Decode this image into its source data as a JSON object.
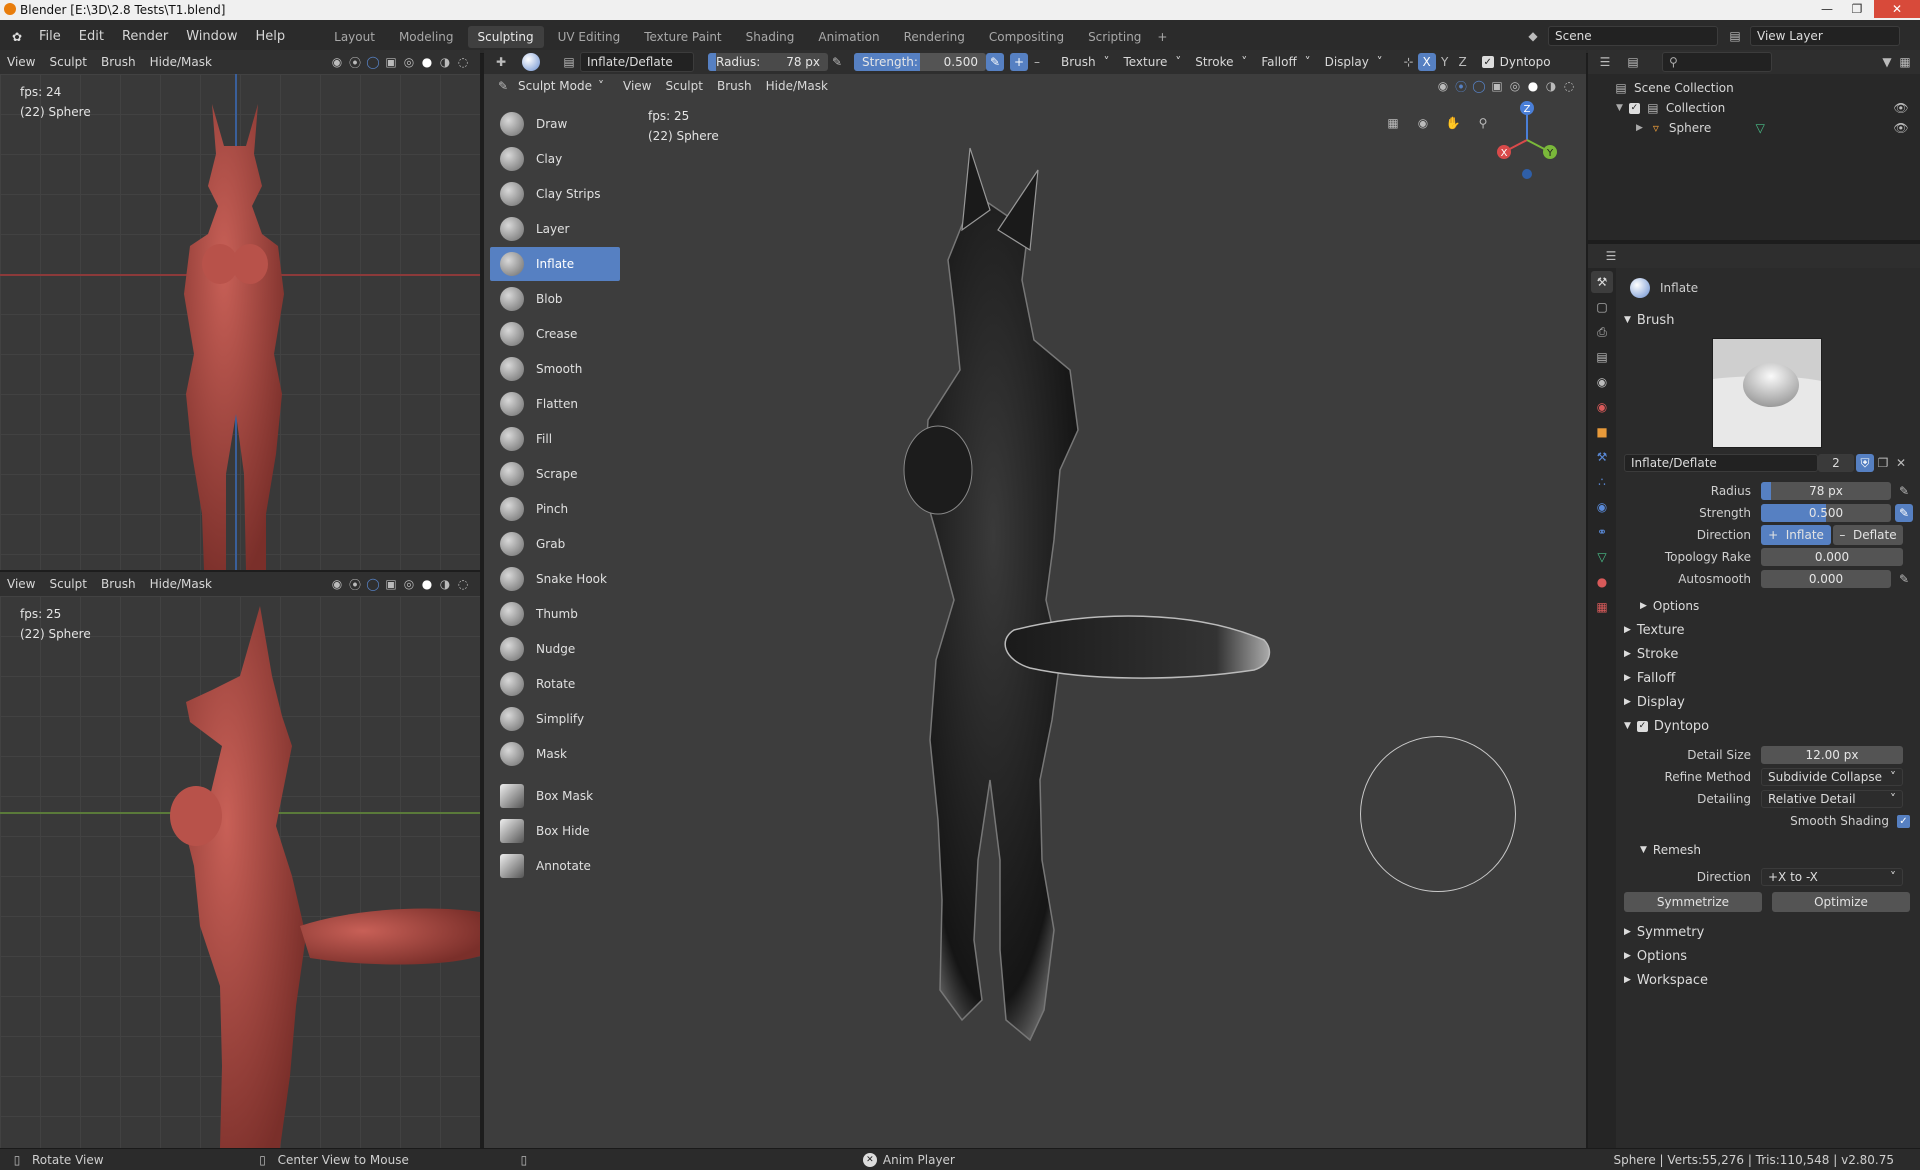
{
  "window": {
    "title": "Blender [E:\\3D\\2.8 Tests\\T1.blend]"
  },
  "menu": [
    "File",
    "Edit",
    "Render",
    "Window",
    "Help"
  ],
  "workspaces": [
    "Layout",
    "Modeling",
    "Sculpting",
    "UV Editing",
    "Texture Paint",
    "Shading",
    "Animation",
    "Rendering",
    "Compositing",
    "Scripting"
  ],
  "active_workspace": "Sculpting",
  "scene_name": "Scene",
  "view_layer": "View Layer",
  "viewport_top": {
    "menus": [
      "View",
      "Sculpt",
      "Brush",
      "Hide/Mask"
    ],
    "fps": "fps: 24",
    "object": "(22) Sphere"
  },
  "viewport_bottom": {
    "menus": [
      "View",
      "Sculpt",
      "Brush",
      "Hide/Mask"
    ],
    "fps": "fps: 25",
    "object": "(22) Sphere"
  },
  "tool_header": {
    "brush_name": "Inflate/Deflate",
    "radius_label": "Radius:",
    "radius_value": "78 px",
    "strength_label": "Strength:",
    "strength_value": "0.500",
    "menus": [
      "Brush",
      "Texture",
      "Stroke",
      "Falloff",
      "Display"
    ],
    "axes": [
      "X",
      "Y",
      "Z"
    ],
    "dyntopo": "Dyntopo"
  },
  "main_viewport": {
    "mode": "Sculpt Mode",
    "menus": [
      "View",
      "Sculpt",
      "Brush",
      "Hide/Mask"
    ],
    "fps": "fps: 25",
    "object": "(22) Sphere"
  },
  "tools": [
    "Draw",
    "Clay",
    "Clay Strips",
    "Layer",
    "Inflate",
    "Blob",
    "Crease",
    "Smooth",
    "Flatten",
    "Fill",
    "Scrape",
    "Pinch",
    "Grab",
    "Snake Hook",
    "Thumb",
    "Nudge",
    "Rotate",
    "Simplify",
    "Mask"
  ],
  "active_tool": "Inflate",
  "extra_tools": [
    "Box Mask",
    "Box Hide",
    "Annotate"
  ],
  "gizmo": {
    "x": "X",
    "y": "Y",
    "z": "Z"
  },
  "outliner": {
    "root": "Scene Collection",
    "collection": "Collection",
    "object": "Sphere"
  },
  "properties": {
    "tool_name": "Inflate",
    "brush_section": "Brush",
    "brush_name": "Inflate/Deflate",
    "brush_users": "2",
    "radius_label": "Radius",
    "radius_value": "78 px",
    "strength_label": "Strength",
    "strength_value": "0.500",
    "strength_fraction": 0.5,
    "direction_label": "Direction",
    "direction_inflate": "Inflate",
    "direction_deflate": "Deflate",
    "topology_rake_label": "Topology Rake",
    "topology_rake_value": "0.000",
    "autosmooth_label": "Autosmooth",
    "autosmooth_value": "0.000",
    "options_sub": "Options",
    "sections_a": [
      "Texture",
      "Stroke",
      "Falloff",
      "Display"
    ],
    "dyntopo_section": "Dyntopo",
    "detail_size_label": "Detail Size",
    "detail_size_value": "12.00 px",
    "refine_method_label": "Refine Method",
    "refine_method_value": "Subdivide Collapse",
    "detailing_label": "Detailing",
    "detailing_value": "Relative Detail",
    "smooth_shading_label": "Smooth Shading",
    "remesh_section": "Remesh",
    "remesh_direction_label": "Direction",
    "remesh_direction_value": "+X to -X",
    "symmetrize_button": "Symmetrize",
    "optimize_button": "Optimize",
    "sections_b": [
      "Symmetry",
      "Options",
      "Workspace"
    ]
  },
  "status": {
    "left1": "Rotate View",
    "left2": "Center View to Mouse",
    "center": "Anim Player",
    "right": "Sphere | Verts:55,276 | Tris:110,548 | v2.80.75"
  },
  "colors": {
    "accent": "#5680c2",
    "model_red": "#b44d45",
    "model_dark": "#222222"
  }
}
